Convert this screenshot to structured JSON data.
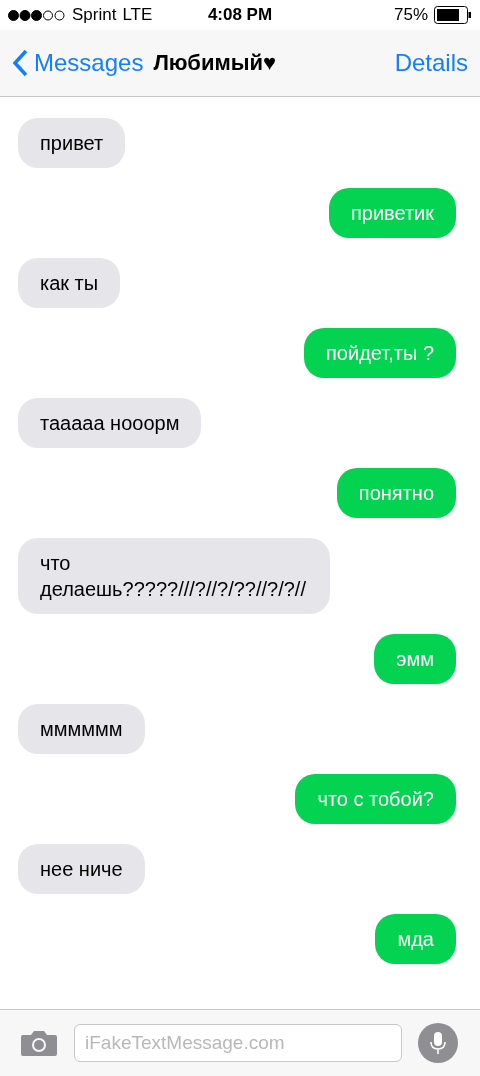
{
  "status_bar": {
    "carrier": "Sprint",
    "network": "LTE",
    "time": "4:08 PM",
    "battery": "75%"
  },
  "nav_bar": {
    "back": "Messages",
    "title": "Любимый♥",
    "action": "Details"
  },
  "messages": [
    {
      "kind": "received",
      "text": "привет"
    },
    {
      "kind": "sent",
      "text": "приветик"
    },
    {
      "kind": "received",
      "text": "как ты"
    },
    {
      "kind": "sent",
      "text": "пойдет,ты ?"
    },
    {
      "kind": "received",
      "text": "тааааа нооорм"
    },
    {
      "kind": "sent",
      "text": "понятно"
    },
    {
      "kind": "received",
      "text": "что делаешь?????///?//?/??//?/?//"
    },
    {
      "kind": "sent",
      "text": "эмм"
    },
    {
      "kind": "received",
      "text": "мммммм"
    },
    {
      "kind": "sent",
      "text": "что с тобой?"
    },
    {
      "kind": "received",
      "text": "нее ниче"
    },
    {
      "kind": "sent",
      "text": "мда"
    }
  ],
  "composer": {
    "placeholder": "iFakeTextMessage.com"
  }
}
